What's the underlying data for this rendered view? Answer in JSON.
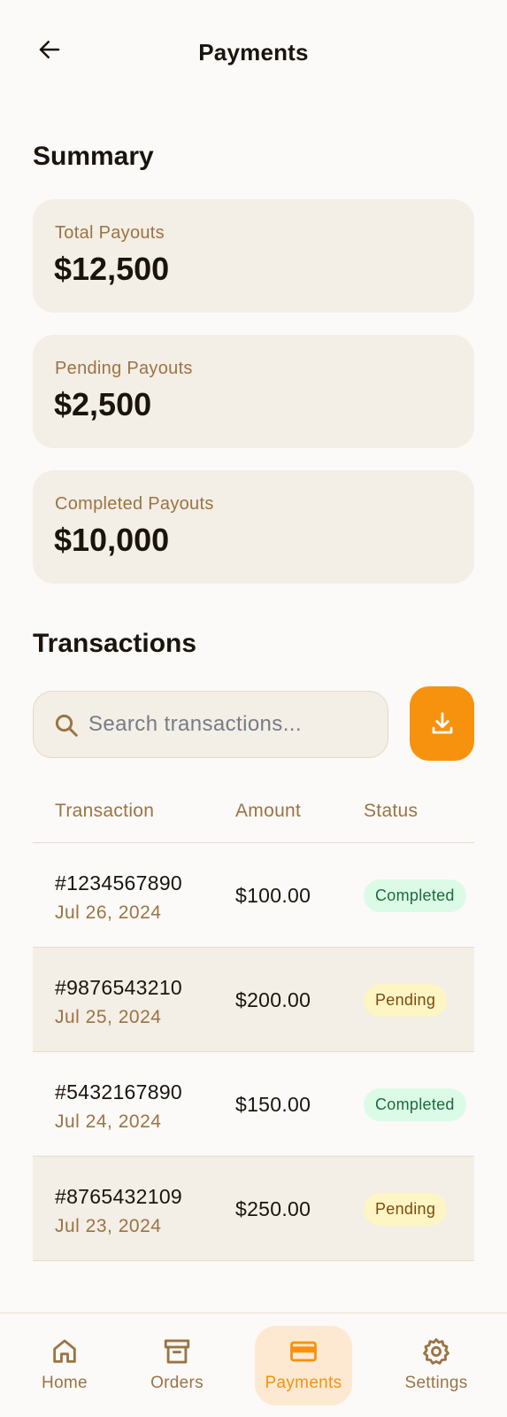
{
  "header": {
    "title": "Payments"
  },
  "summary": {
    "title": "Summary",
    "cards": [
      {
        "label": "Total Payouts",
        "value": "$12,500"
      },
      {
        "label": "Pending Payouts",
        "value": "$2,500"
      },
      {
        "label": "Completed Payouts",
        "value": "$10,000"
      }
    ]
  },
  "transactions": {
    "title": "Transactions",
    "search_placeholder": "Search transactions...",
    "columns": [
      "Transaction",
      "Amount",
      "Status"
    ],
    "rows": [
      {
        "id": "#1234567890",
        "date": "Jul 26, 2024",
        "amount": "$100.00",
        "status": "Completed"
      },
      {
        "id": "#9876543210",
        "date": "Jul 25, 2024",
        "amount": "$200.00",
        "status": "Pending"
      },
      {
        "id": "#5432167890",
        "date": "Jul 24, 2024",
        "amount": "$150.00",
        "status": "Completed"
      },
      {
        "id": "#8765432109",
        "date": "Jul 23, 2024",
        "amount": "$250.00",
        "status": "Pending"
      }
    ]
  },
  "nav": {
    "items": [
      {
        "label": "Home",
        "icon": "home-icon"
      },
      {
        "label": "Orders",
        "icon": "archive-box-icon"
      },
      {
        "label": "Payments",
        "icon": "credit-card-icon",
        "active": true
      },
      {
        "label": "Settings",
        "icon": "gear-icon"
      }
    ]
  },
  "colors": {
    "accent": "#f7920f",
    "muted_text": "#9a7444",
    "card_bg": "#f3eee6",
    "completed_bg": "#dcfbe7",
    "pending_bg": "#fdf6c4"
  }
}
